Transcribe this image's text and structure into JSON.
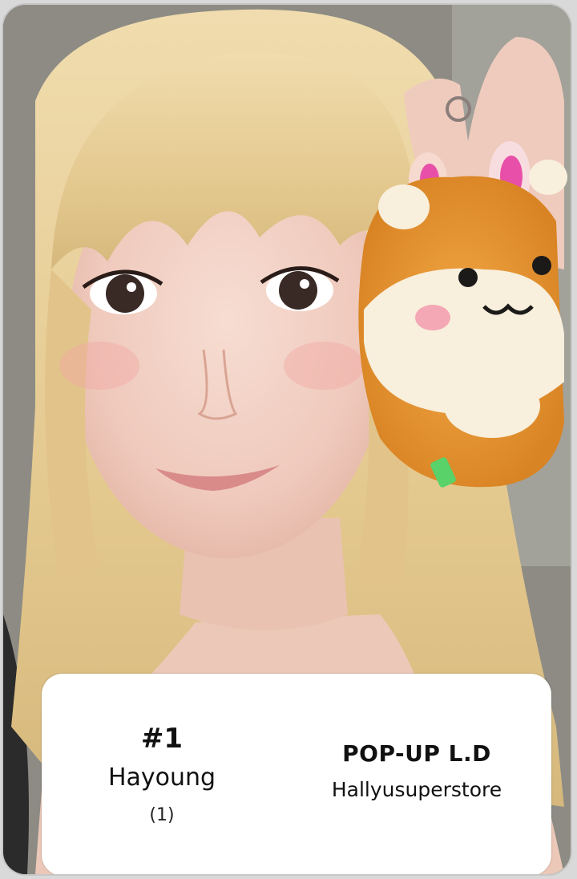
{
  "card": {
    "number": "#1",
    "member_name": "Hayoung",
    "count": "(1)",
    "event": "POP-UP L.D",
    "store": "Hallyusuperstore"
  },
  "photo": {
    "subject": "portrait-with-plush-toy",
    "colors": {
      "hair": "#e6cf9a",
      "skin": "#f3d2c6",
      "plush_orange": "#e8962e",
      "plush_cream": "#f8efdc",
      "nail_pink": "#e84fa8"
    }
  }
}
